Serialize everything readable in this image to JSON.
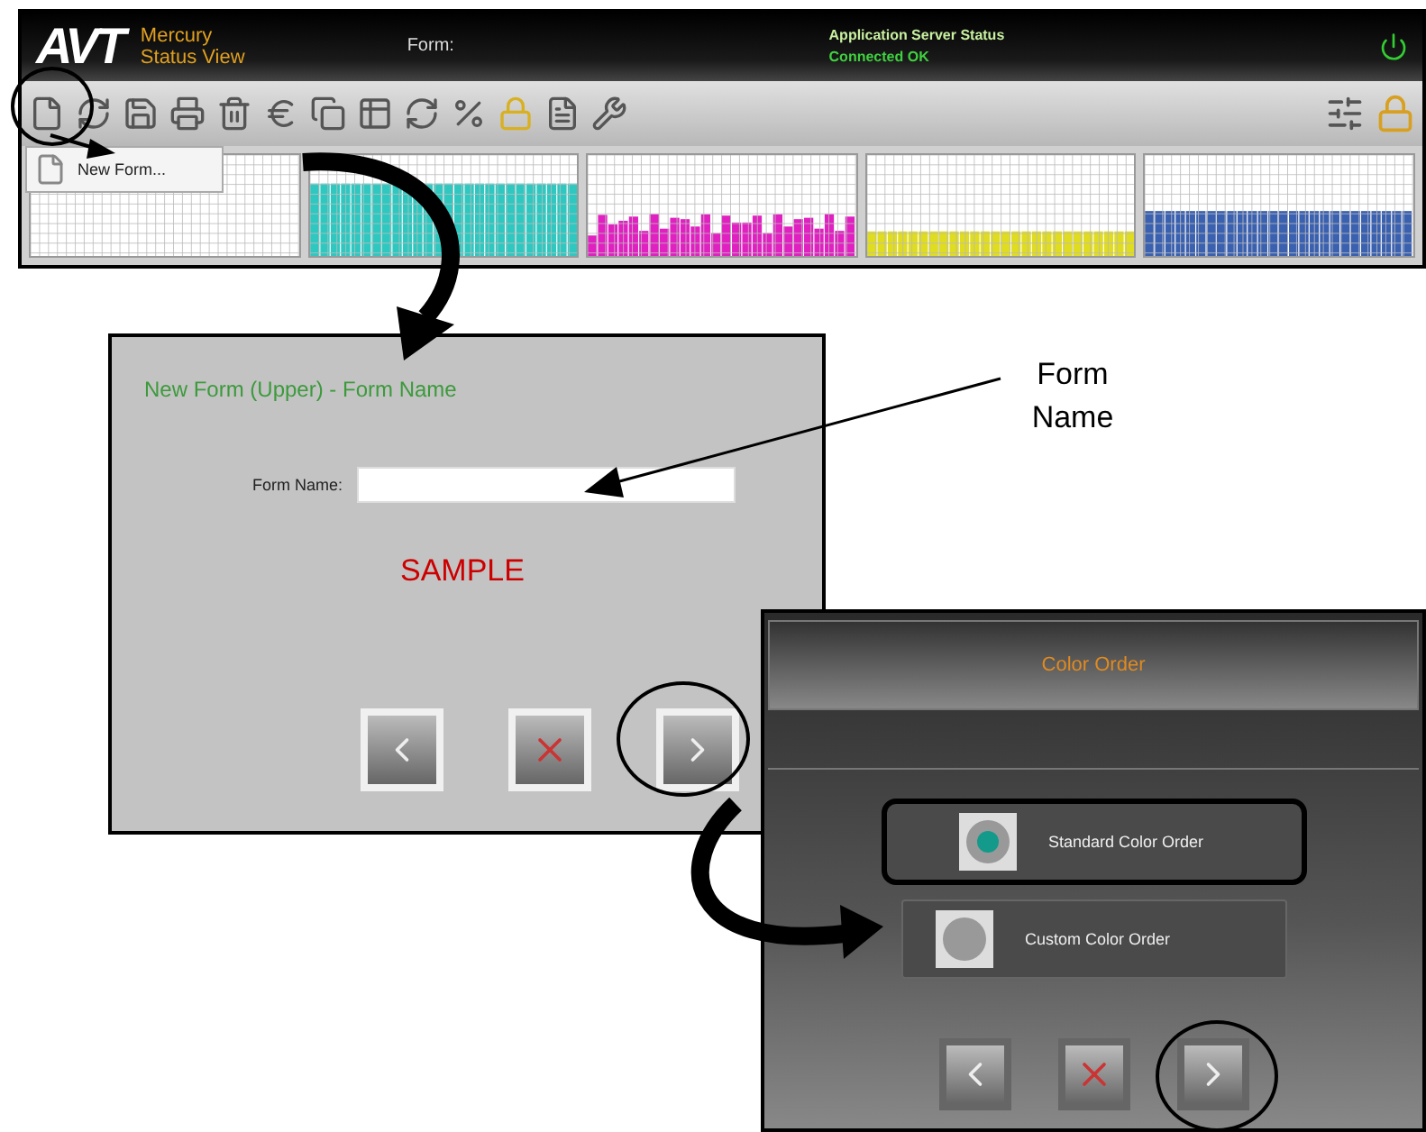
{
  "app_window": {
    "logo": "AVT",
    "app_name": "Mercury",
    "view_name": "Status View",
    "form_label": "Form:",
    "server_status_label": "Application Server Status",
    "server_status": "Connected OK",
    "menu": {
      "items": [
        {
          "label": "New Form..."
        }
      ]
    },
    "panels": [
      {
        "color": "#d8d8ec"
      },
      {
        "color": "#2ec8c0"
      },
      {
        "color": "#e020c0"
      },
      {
        "color": "#e0dc20"
      },
      {
        "color": "#3a60b0"
      }
    ]
  },
  "form_name_dialog": {
    "title": "New Form (Upper) - Form Name",
    "field_label": "Form Name:",
    "stamp": "SAMPLE"
  },
  "callout": {
    "text": "Form Name"
  },
  "color_order_dialog": {
    "title": "Color Order",
    "options": [
      {
        "label": "Standard Color Order",
        "selected": true
      },
      {
        "label": "Custom Color Order",
        "selected": false
      }
    ]
  }
}
